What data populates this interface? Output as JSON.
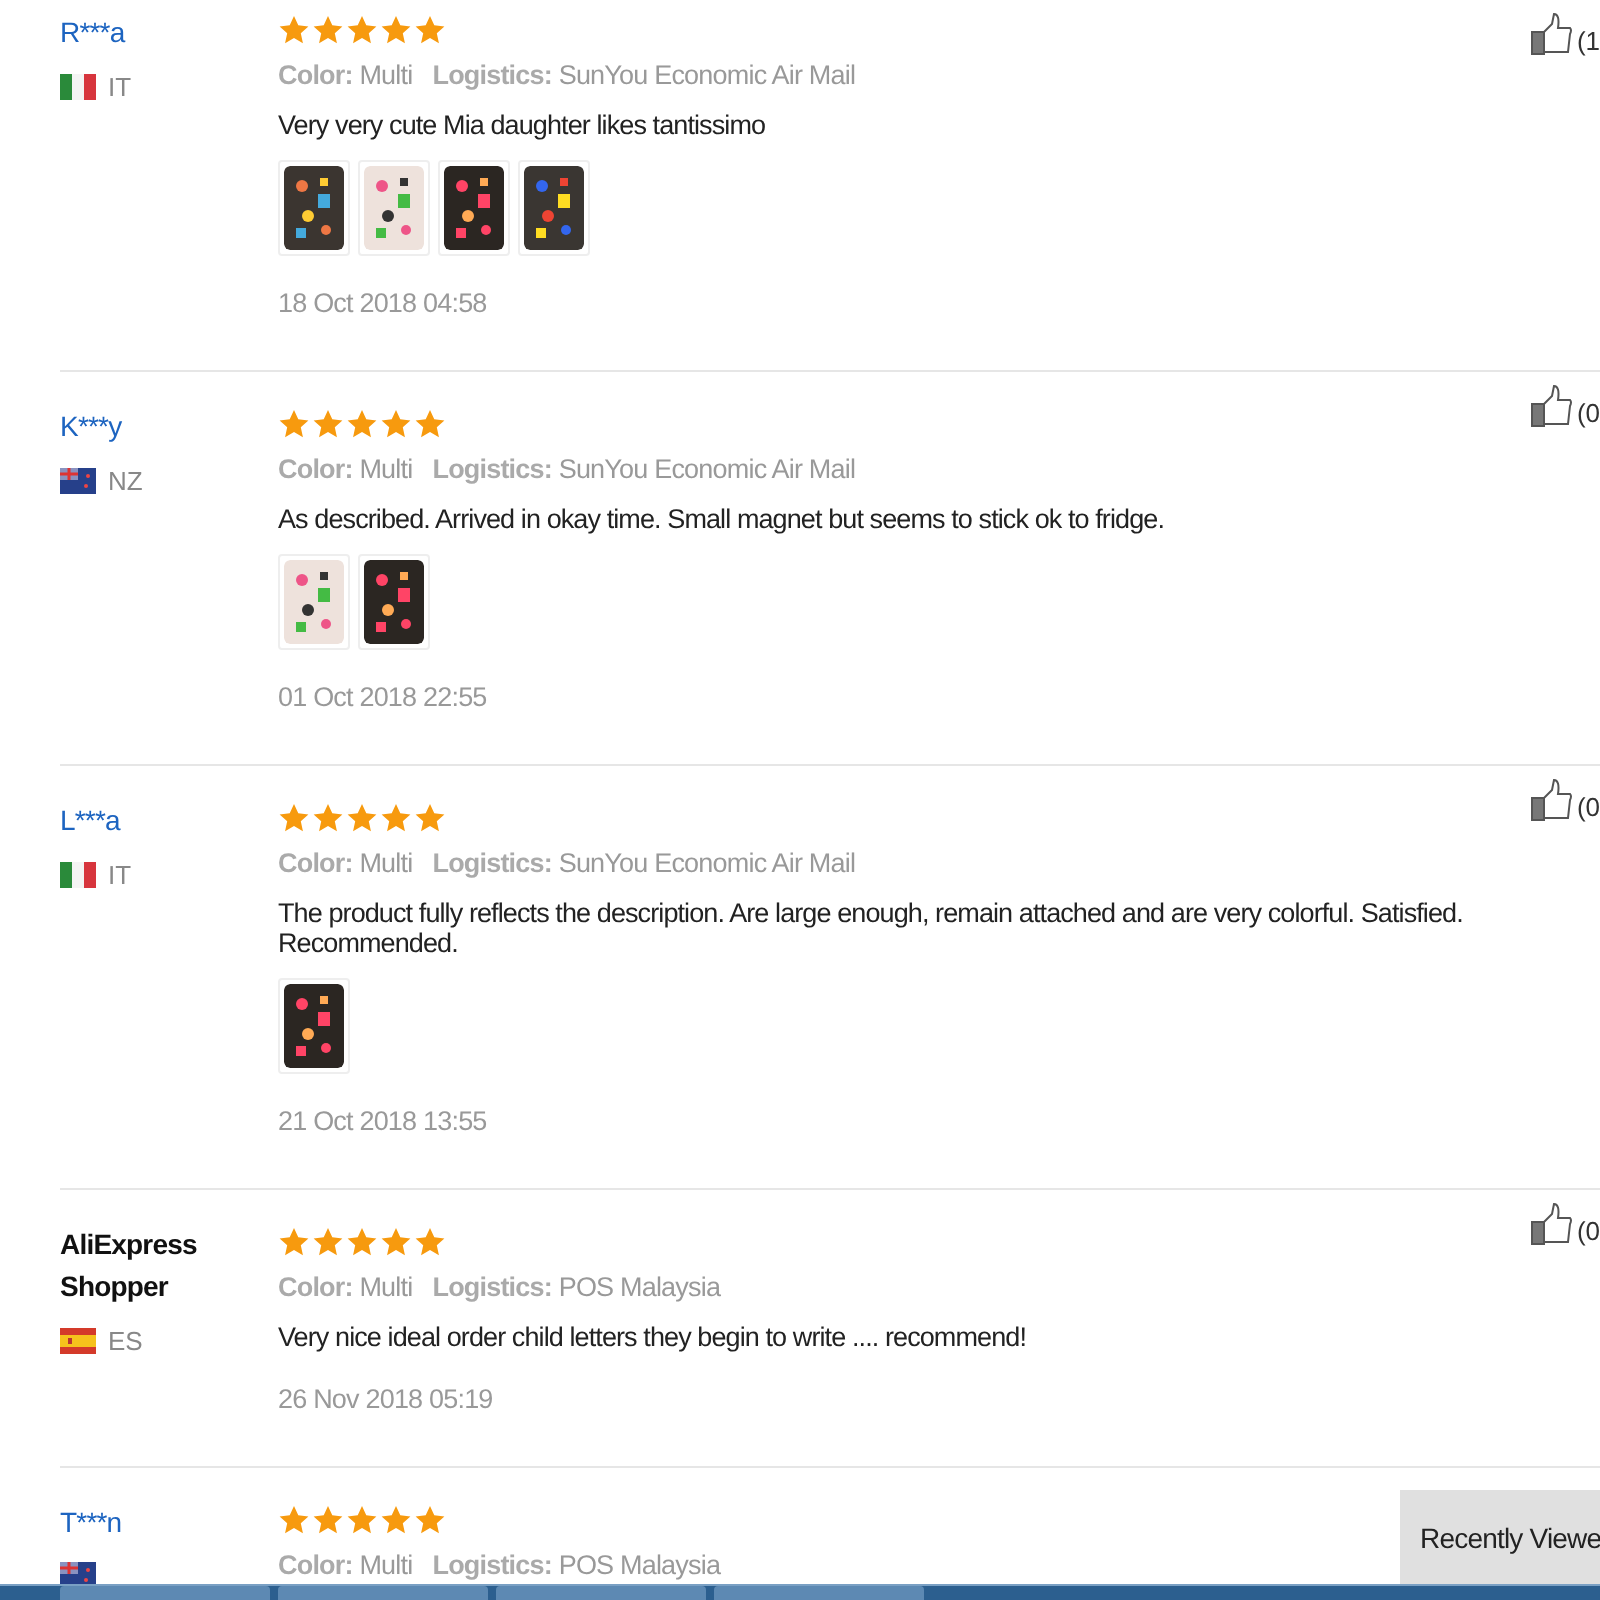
{
  "reviews": [
    {
      "name": "R***a",
      "linked": true,
      "flag": {
        "kind": "italy"
      },
      "country": "IT",
      "stars": 5,
      "color_label": "Color:",
      "color_value": "Multi",
      "logistics_label": "Logistics:",
      "logistics_value": "SunYou Economic Air Mail",
      "text": "Very very cute Mia daughter likes tantissimo",
      "photos": [
        {
          "kind": "picture"
        },
        {
          "kind": "picture"
        },
        {
          "kind": "picture"
        },
        {
          "kind": "picture"
        }
      ],
      "date": "18 Oct 2018 04:58",
      "likes": "(1"
    },
    {
      "name": "K***y",
      "linked": true,
      "flag": {
        "kind": "newzealand"
      },
      "country": "NZ",
      "stars": 5,
      "color_label": "Color:",
      "color_value": "Multi",
      "logistics_label": "Logistics:",
      "logistics_value": "SunYou Economic Air Mail",
      "text": "As described. Arrived in okay time. Small magnet but seems to stick ok to fridge.",
      "photos": [
        {
          "kind": "picture"
        },
        {
          "kind": "picture"
        }
      ],
      "date": "01 Oct 2018 22:55",
      "likes": "(0"
    },
    {
      "name": "L***a",
      "linked": true,
      "flag": {
        "kind": "italy"
      },
      "country": "IT",
      "stars": 5,
      "color_label": "Color:",
      "color_value": "Multi",
      "logistics_label": "Logistics:",
      "logistics_value": "SunYou Economic Air Mail",
      "text": "The product fully reflects the description. Are large enough, remain attached and are very colorful. Satisfied. Recommended.",
      "photos": [
        {
          "kind": "picture"
        }
      ],
      "date": "21 Oct 2018 13:55",
      "likes": "(0"
    },
    {
      "name": "AliExpress Shopper",
      "linked": false,
      "flag": {
        "kind": "spain"
      },
      "country": "ES",
      "stars": 5,
      "color_label": "Color:",
      "color_value": "Multi",
      "logistics_label": "Logistics:",
      "logistics_value": "POS Malaysia",
      "text": "Very nice ideal order child letters they begin to write .... recommend!",
      "date": "26 Nov 2018 05:19",
      "likes": "(0"
    },
    {
      "name": "T***n",
      "linked": true,
      "flag": {
        "kind": "newzealand"
      },
      "stars": 5,
      "color_label": "Color:",
      "color_value": "Multi",
      "logistics_label": "Logistics:",
      "logistics_value": "POS Malaysia"
    }
  ],
  "recently_viewed": "Recently Viewe"
}
